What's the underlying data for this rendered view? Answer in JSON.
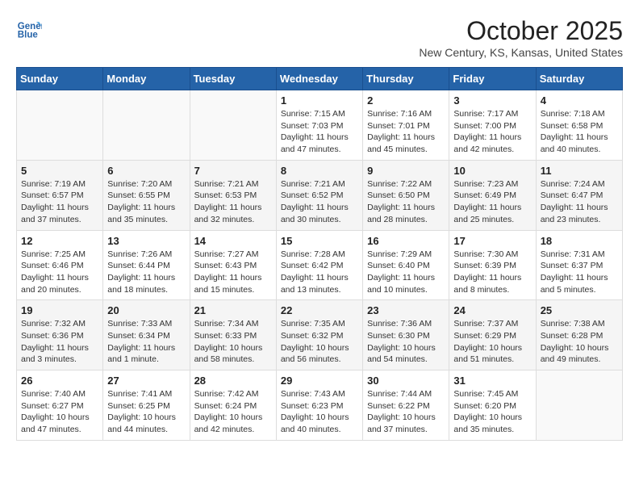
{
  "header": {
    "logo_line1": "General",
    "logo_line2": "Blue",
    "month_title": "October 2025",
    "location": "New Century, KS, Kansas, United States"
  },
  "weekdays": [
    "Sunday",
    "Monday",
    "Tuesday",
    "Wednesday",
    "Thursday",
    "Friday",
    "Saturday"
  ],
  "weeks": [
    [
      {
        "day": "",
        "info": ""
      },
      {
        "day": "",
        "info": ""
      },
      {
        "day": "",
        "info": ""
      },
      {
        "day": "1",
        "info": "Sunrise: 7:15 AM\nSunset: 7:03 PM\nDaylight: 11 hours\nand 47 minutes."
      },
      {
        "day": "2",
        "info": "Sunrise: 7:16 AM\nSunset: 7:01 PM\nDaylight: 11 hours\nand 45 minutes."
      },
      {
        "day": "3",
        "info": "Sunrise: 7:17 AM\nSunset: 7:00 PM\nDaylight: 11 hours\nand 42 minutes."
      },
      {
        "day": "4",
        "info": "Sunrise: 7:18 AM\nSunset: 6:58 PM\nDaylight: 11 hours\nand 40 minutes."
      }
    ],
    [
      {
        "day": "5",
        "info": "Sunrise: 7:19 AM\nSunset: 6:57 PM\nDaylight: 11 hours\nand 37 minutes."
      },
      {
        "day": "6",
        "info": "Sunrise: 7:20 AM\nSunset: 6:55 PM\nDaylight: 11 hours\nand 35 minutes."
      },
      {
        "day": "7",
        "info": "Sunrise: 7:21 AM\nSunset: 6:53 PM\nDaylight: 11 hours\nand 32 minutes."
      },
      {
        "day": "8",
        "info": "Sunrise: 7:21 AM\nSunset: 6:52 PM\nDaylight: 11 hours\nand 30 minutes."
      },
      {
        "day": "9",
        "info": "Sunrise: 7:22 AM\nSunset: 6:50 PM\nDaylight: 11 hours\nand 28 minutes."
      },
      {
        "day": "10",
        "info": "Sunrise: 7:23 AM\nSunset: 6:49 PM\nDaylight: 11 hours\nand 25 minutes."
      },
      {
        "day": "11",
        "info": "Sunrise: 7:24 AM\nSunset: 6:47 PM\nDaylight: 11 hours\nand 23 minutes."
      }
    ],
    [
      {
        "day": "12",
        "info": "Sunrise: 7:25 AM\nSunset: 6:46 PM\nDaylight: 11 hours\nand 20 minutes."
      },
      {
        "day": "13",
        "info": "Sunrise: 7:26 AM\nSunset: 6:44 PM\nDaylight: 11 hours\nand 18 minutes."
      },
      {
        "day": "14",
        "info": "Sunrise: 7:27 AM\nSunset: 6:43 PM\nDaylight: 11 hours\nand 15 minutes."
      },
      {
        "day": "15",
        "info": "Sunrise: 7:28 AM\nSunset: 6:42 PM\nDaylight: 11 hours\nand 13 minutes."
      },
      {
        "day": "16",
        "info": "Sunrise: 7:29 AM\nSunset: 6:40 PM\nDaylight: 11 hours\nand 10 minutes."
      },
      {
        "day": "17",
        "info": "Sunrise: 7:30 AM\nSunset: 6:39 PM\nDaylight: 11 hours\nand 8 minutes."
      },
      {
        "day": "18",
        "info": "Sunrise: 7:31 AM\nSunset: 6:37 PM\nDaylight: 11 hours\nand 5 minutes."
      }
    ],
    [
      {
        "day": "19",
        "info": "Sunrise: 7:32 AM\nSunset: 6:36 PM\nDaylight: 11 hours\nand 3 minutes."
      },
      {
        "day": "20",
        "info": "Sunrise: 7:33 AM\nSunset: 6:34 PM\nDaylight: 11 hours\nand 1 minute."
      },
      {
        "day": "21",
        "info": "Sunrise: 7:34 AM\nSunset: 6:33 PM\nDaylight: 10 hours\nand 58 minutes."
      },
      {
        "day": "22",
        "info": "Sunrise: 7:35 AM\nSunset: 6:32 PM\nDaylight: 10 hours\nand 56 minutes."
      },
      {
        "day": "23",
        "info": "Sunrise: 7:36 AM\nSunset: 6:30 PM\nDaylight: 10 hours\nand 54 minutes."
      },
      {
        "day": "24",
        "info": "Sunrise: 7:37 AM\nSunset: 6:29 PM\nDaylight: 10 hours\nand 51 minutes."
      },
      {
        "day": "25",
        "info": "Sunrise: 7:38 AM\nSunset: 6:28 PM\nDaylight: 10 hours\nand 49 minutes."
      }
    ],
    [
      {
        "day": "26",
        "info": "Sunrise: 7:40 AM\nSunset: 6:27 PM\nDaylight: 10 hours\nand 47 minutes."
      },
      {
        "day": "27",
        "info": "Sunrise: 7:41 AM\nSunset: 6:25 PM\nDaylight: 10 hours\nand 44 minutes."
      },
      {
        "day": "28",
        "info": "Sunrise: 7:42 AM\nSunset: 6:24 PM\nDaylight: 10 hours\nand 42 minutes."
      },
      {
        "day": "29",
        "info": "Sunrise: 7:43 AM\nSunset: 6:23 PM\nDaylight: 10 hours\nand 40 minutes."
      },
      {
        "day": "30",
        "info": "Sunrise: 7:44 AM\nSunset: 6:22 PM\nDaylight: 10 hours\nand 37 minutes."
      },
      {
        "day": "31",
        "info": "Sunrise: 7:45 AM\nSunset: 6:20 PM\nDaylight: 10 hours\nand 35 minutes."
      },
      {
        "day": "",
        "info": ""
      }
    ]
  ]
}
